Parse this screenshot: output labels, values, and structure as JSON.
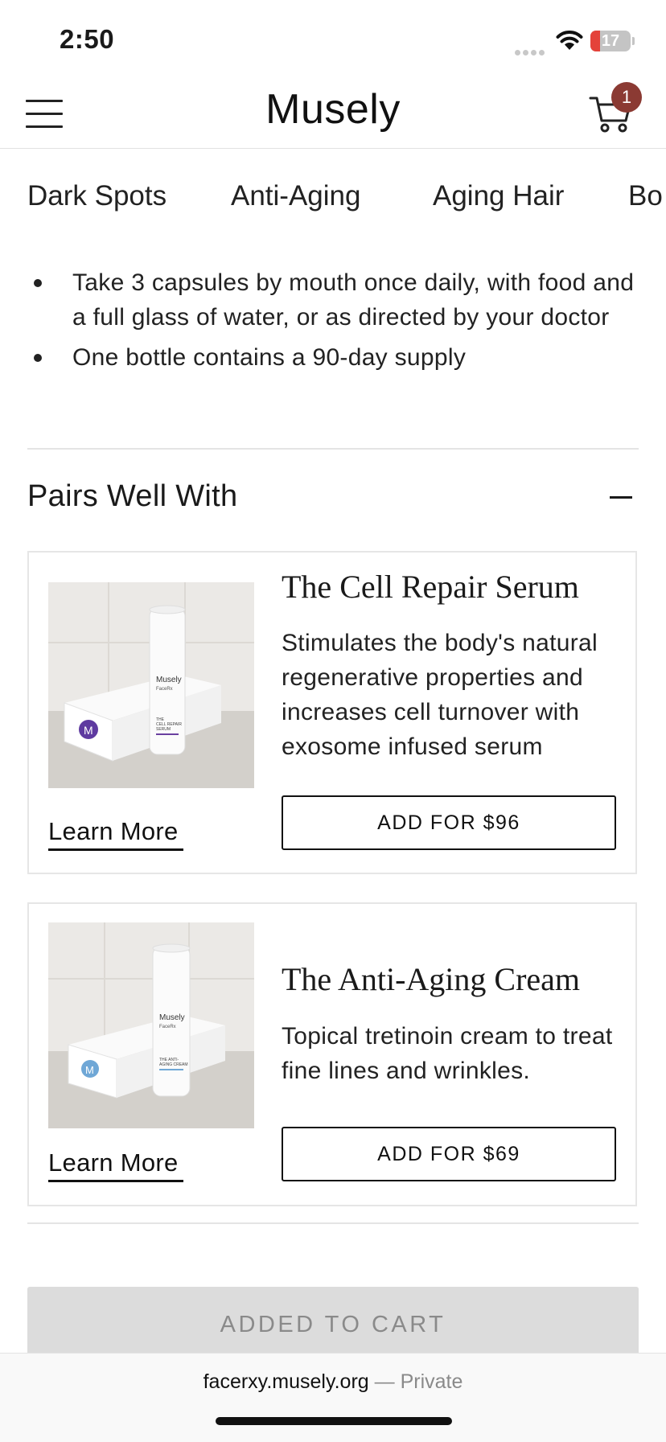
{
  "status_bar": {
    "time": "2:50",
    "battery": "17"
  },
  "header": {
    "brand": "Musely",
    "cart_count": "1"
  },
  "nav": {
    "items": [
      "Dark Spots",
      "Anti-Aging",
      "Aging Hair",
      "Bo"
    ]
  },
  "directions": [
    "Take 3 capsules by mouth once daily, with food and a full glass of water, or as directed by your doctor",
    "One bottle contains a 90-day supply"
  ],
  "pairs": {
    "title": "Pairs Well With",
    "products": [
      {
        "name": "The Cell Repair Serum",
        "description": "Stimulates the body's natural regenerative properties and increases cell turnover with exosome infused serum",
        "button": "ADD FOR $96",
        "learn_more": "Learn More",
        "image_brand": "Musely",
        "image_sub": "FaceRx",
        "image_label": "THE\nCELL REPAIR\nSERUM",
        "accent": "#6a3fa0"
      },
      {
        "name": "The Anti-Aging Cream",
        "description": "Topical tretinoin cream to treat fine lines and wrinkles.",
        "button": "ADD FOR $69",
        "learn_more": "Learn More",
        "image_brand": "Musely",
        "image_sub": "FaceRx",
        "image_label": "THE ANTI-\nAGING CREAM",
        "accent": "#6fa7d6"
      }
    ]
  },
  "cart_button": "ADDED TO CART",
  "browser": {
    "url": "facerxy.musely.org",
    "privacy": "— Private"
  }
}
